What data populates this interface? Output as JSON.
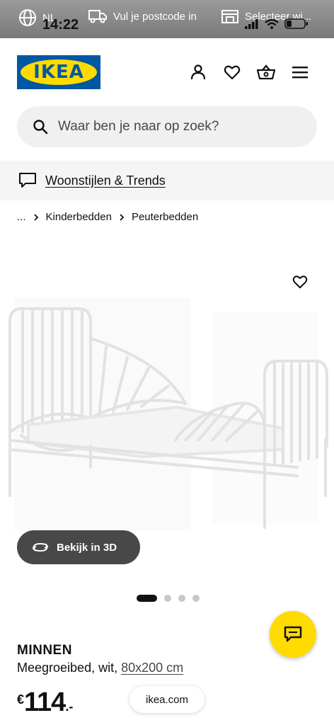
{
  "status_bar": {
    "region": "NL",
    "time": "14:22",
    "postcode": "Vul je postcode in",
    "store": "Selecteer wi..."
  },
  "header": {
    "logo_text": "IKEA",
    "icons": [
      "person-icon",
      "heart-icon",
      "basket-icon",
      "menu-icon"
    ]
  },
  "search": {
    "placeholder": "Waar ben je naar op zoek?"
  },
  "banner": {
    "label": "Woonstijlen & Trends"
  },
  "breadcrumb": {
    "ellipsis": "...",
    "items": [
      "Kinderbedden",
      "Peuterbedden"
    ]
  },
  "product": {
    "view_3d": "Bekijk in 3D",
    "carousel": {
      "total": 4,
      "active": 1
    },
    "name": "MINNEN",
    "desc_prefix": "Meegroeibed, wit, ",
    "size": "80x200 cm",
    "price_currency": "€",
    "price_int": "114",
    "price_dec": ".-"
  },
  "url": "ikea.com",
  "colors": {
    "ikea_blue": "#0058a3",
    "ikea_yellow": "#ffdb00",
    "dark_button": "#484848"
  }
}
